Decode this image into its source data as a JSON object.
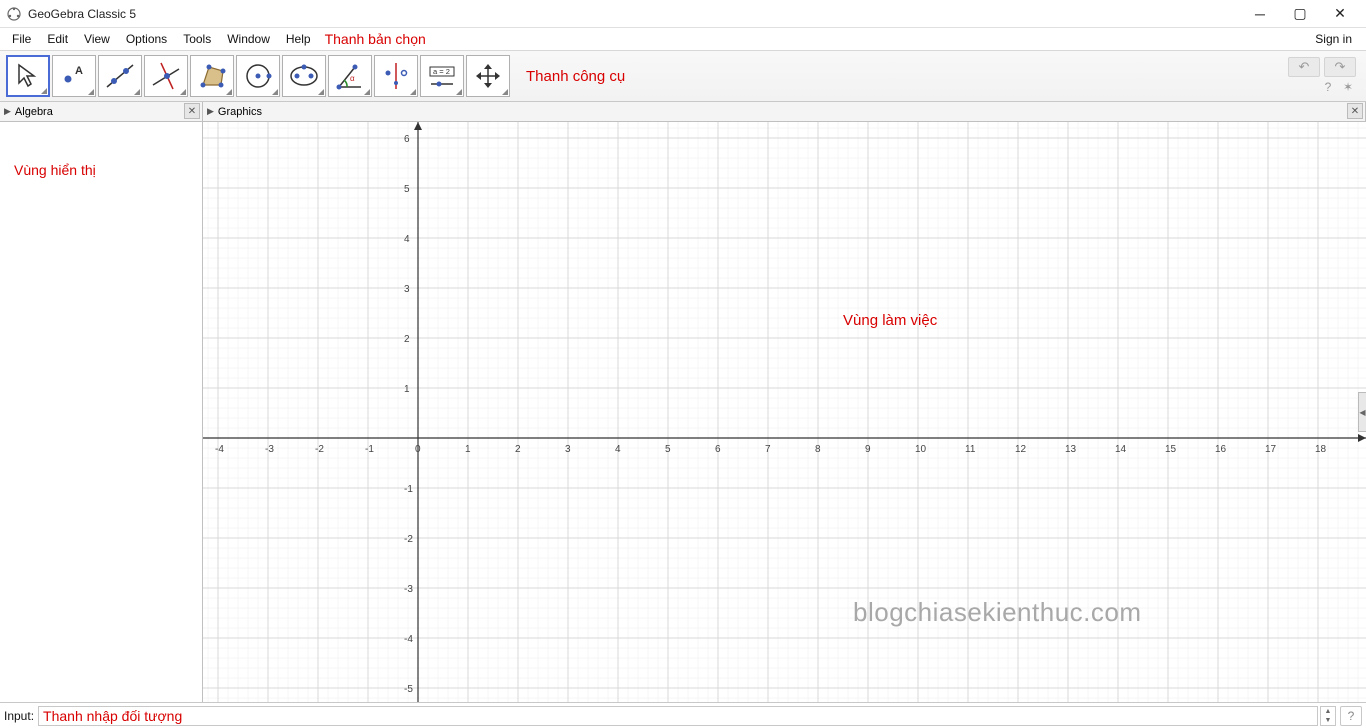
{
  "title": "GeoGebra Classic 5",
  "menu": {
    "items": [
      "File",
      "Edit",
      "View",
      "Options",
      "Tools",
      "Window",
      "Help"
    ],
    "annotation": "Thanh bản chọn",
    "signin": "Sign in"
  },
  "toolbar": {
    "annotation": "Thanh công cụ",
    "tools": [
      {
        "name": "move-tool",
        "active": true
      },
      {
        "name": "point-tool"
      },
      {
        "name": "line-tool"
      },
      {
        "name": "perpendicular-tool"
      },
      {
        "name": "polygon-tool"
      },
      {
        "name": "circle-tool"
      },
      {
        "name": "ellipse-tool"
      },
      {
        "name": "angle-tool"
      },
      {
        "name": "reflect-tool"
      },
      {
        "name": "slider-tool",
        "text": "a = 2"
      },
      {
        "name": "move-view-tool"
      }
    ]
  },
  "panels": {
    "algebra": {
      "title": "Algebra",
      "annotation": "Vùng hiển thị"
    },
    "graphics": {
      "title": "Graphics",
      "annotation": "Vùng làm việc",
      "watermark": "blogchiasekienthuc.com",
      "xaxis": {
        "min": -4,
        "max": 18,
        "step": 1,
        "origin_idx": 4
      },
      "yaxis": {
        "min": -5,
        "max": 6,
        "step": 1
      }
    }
  },
  "input": {
    "label": "Input:",
    "value": "Thanh nhập đối tượng"
  }
}
